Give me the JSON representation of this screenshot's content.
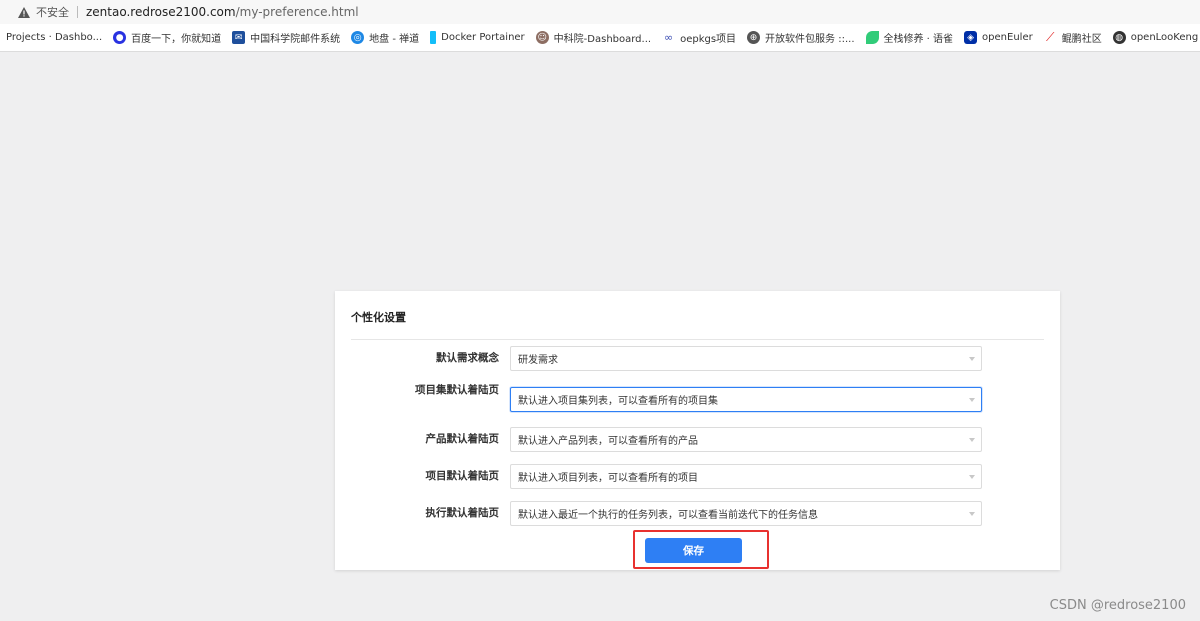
{
  "browser": {
    "insecure_label": "不安全",
    "url_host": "zentao.redrose2100.com",
    "url_path": "/my-preference.html"
  },
  "bookmarks": [
    {
      "label": "Projects · Dashbo...",
      "icon": "gitlab-icon",
      "color": "#e24329"
    },
    {
      "label": "百度一下，你就知道",
      "icon": "baidu-paw-icon",
      "color": "#2932e1"
    },
    {
      "label": "中国科学院邮件系统",
      "icon": "mail-icon",
      "color": "#1e4f9c"
    },
    {
      "label": "地盘 - 禅道",
      "icon": "zentao-icon",
      "color": "#1e88e5"
    },
    {
      "label": "Docker Portainer",
      "icon": "portainer-icon",
      "color": "#13bef9"
    },
    {
      "label": "中科院-Dashboard...",
      "icon": "avatar-icon",
      "color": "#8d6e63"
    },
    {
      "label": "oepkgs项目",
      "icon": "oepkgs-icon",
      "color": "#3f51b5"
    },
    {
      "label": "开放软件包服务 ::...",
      "icon": "globe-icon",
      "color": "#555555"
    },
    {
      "label": "全栈修养 · 语雀",
      "icon": "yuque-icon",
      "color": "#31cc79"
    },
    {
      "label": "openEuler",
      "icon": "openeuler-icon",
      "color": "#002fa7"
    },
    {
      "label": "鲲鹏社区",
      "icon": "kunpeng-icon",
      "color": "#e02020"
    },
    {
      "label": "openLooKeng",
      "icon": "openlookeng-icon",
      "color": "#333333"
    }
  ],
  "panel": {
    "title": "个性化设置",
    "rows": [
      {
        "label": "默认需求概念",
        "value": "研发需求"
      },
      {
        "label": "项目集默认着陆页",
        "value": "默认进入项目集列表，可以查看所有的项目集"
      },
      {
        "label": "产品默认着陆页",
        "value": "默认进入产品列表，可以查看所有的产品"
      },
      {
        "label": "项目默认着陆页",
        "value": "默认进入项目列表，可以查看所有的项目"
      },
      {
        "label": "执行默认着陆页",
        "value": "默认进入最近一个执行的任务列表，可以查看当前迭代下的任务信息"
      }
    ],
    "save_label": "保存"
  },
  "colors": {
    "accent": "#2e7ff4",
    "highlight_border": "#e8312f",
    "page_background": "#efeff0"
  },
  "watermark": "CSDN @redrose2100"
}
